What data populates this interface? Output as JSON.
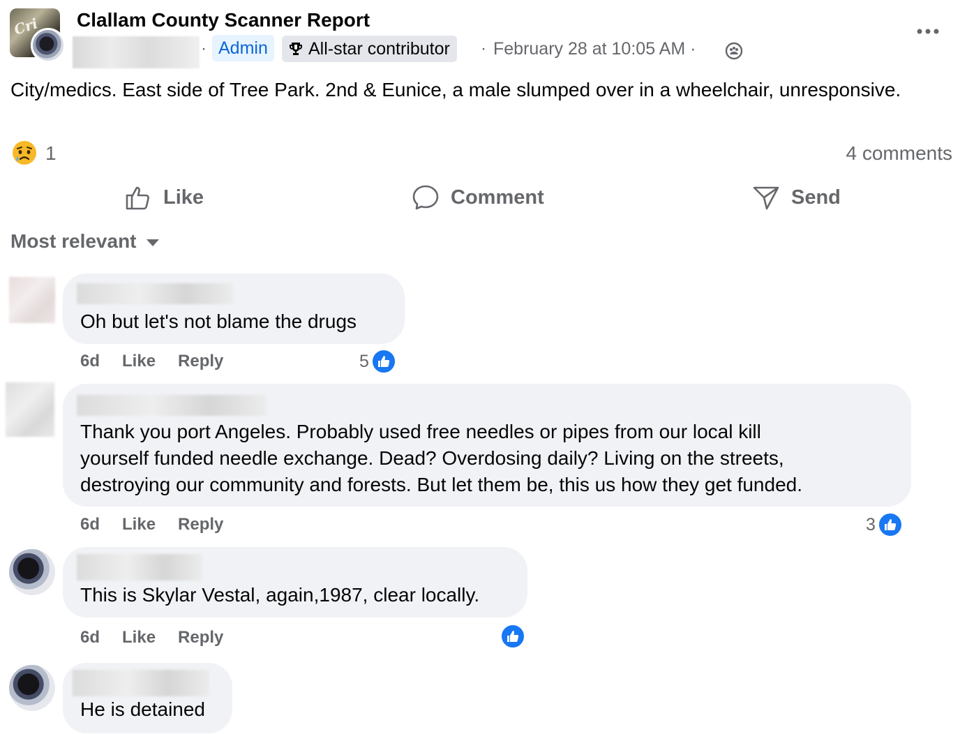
{
  "post": {
    "group_name": "Clallam County Scanner Report",
    "admin_badge": "Admin",
    "contributor_badge": "All-star contributor",
    "separator": "·",
    "timestamp": "February 28 at 10:05 AM",
    "avatar_lettering": "Cri",
    "body": "City/medics. East side of Tree Park. 2nd & Eunice, a male slumped over in a wheelchair, unresponsive.",
    "reaction_count": "1",
    "comment_count": "4 comments",
    "icons": {
      "more": "more-options-icon",
      "audience": "group-audience-icon",
      "reaction": "sad-reaction-icon",
      "trophy": "trophy-icon"
    }
  },
  "actions": {
    "like": "Like",
    "comment": "Comment",
    "send": "Send"
  },
  "sort": {
    "label": "Most relevant"
  },
  "comments": [
    {
      "text": "Oh but let's not blame the drugs",
      "time": "6d",
      "like": "Like",
      "reply": "Reply",
      "likes": "5"
    },
    {
      "text": "Thank you port Angeles. Probably used free needles or pipes from our local kill\nyourself funded needle exchange. Dead? Overdosing daily? Living on the streets,\ndestroying our community and forests. But let them be, this us how they get funded.",
      "time": "6d",
      "like": "Like",
      "reply": "Reply",
      "likes": "3"
    },
    {
      "text": "This is Skylar Vestal, again,1987, clear locally.",
      "time": "6d",
      "like": "Like",
      "reply": "Reply",
      "likes": ""
    },
    {
      "text": "He is detained"
    }
  ],
  "colors": {
    "accent": "#1877f2",
    "secondary_text": "#65676b",
    "bubble": "#f0f2f5",
    "admin_bg": "#e7f3ff",
    "admin_text": "#0a66d8"
  }
}
